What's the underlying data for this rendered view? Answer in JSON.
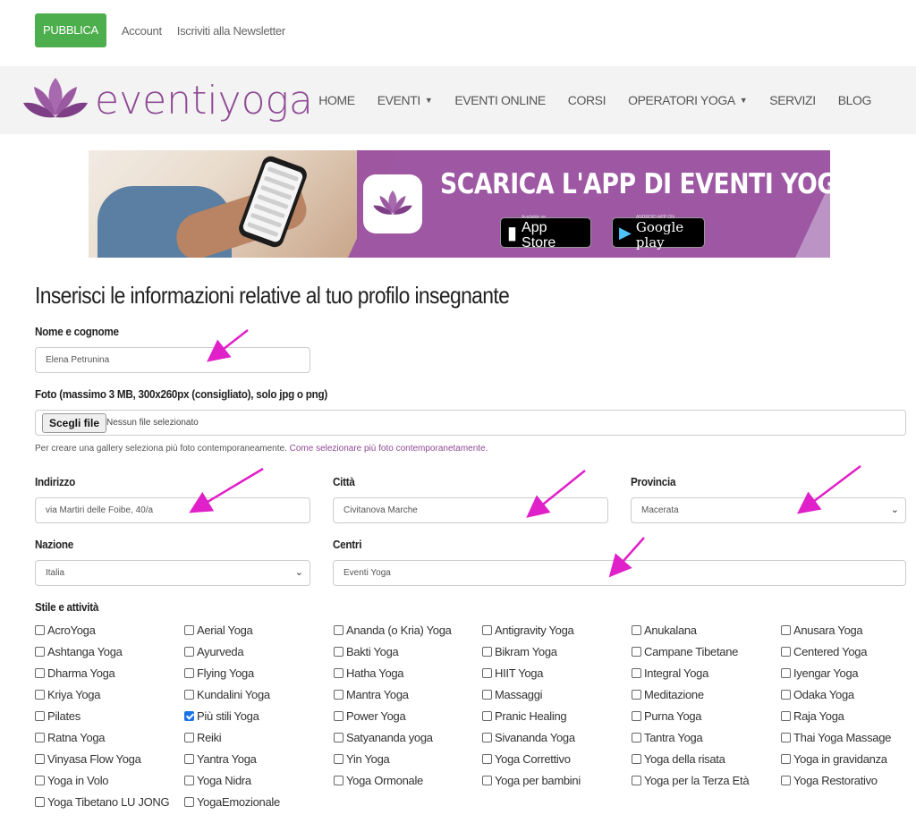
{
  "topbar": {
    "publish_label": "PUBBLICA",
    "account_label": "Account",
    "newsletter_label": "Iscriviti alla Newsletter"
  },
  "brand": {
    "logo_text": "eventiyoga",
    "color": "#8e4a94"
  },
  "nav": {
    "items": [
      "HOME",
      "EVENTI",
      "EVENTI ONLINE",
      "CORSI",
      "OPERATORI YOGA",
      "SERVIZI",
      "BLOG"
    ]
  },
  "banner": {
    "title": "SCARICA L'APP  DI EVENTI YOGA",
    "apple_small": "Available on",
    "apple_label": "App Store",
    "google_small": "ANDROID APP ON",
    "google_label": "Google play"
  },
  "form": {
    "title": "Inserisci le informazioni relative al tuo profilo insegnante",
    "name_label": "Nome e cognome",
    "name_value": "Elena Petrunina",
    "photo_label": "Foto (massimo 3 MB, 300x260px (consigliato), solo jpg o png)",
    "file_button": "Scegli file",
    "file_status": "Nessun file selezionato",
    "hint_text": "Per creare una gallery seleziona più foto contemporaneamente.",
    "hint_link": "Come selezionare più foto contemporanetamente.",
    "address_label": "Indirizzo",
    "address_value": "via Martiri delle Foibe, 40/a",
    "city_label": "Città",
    "city_value": "Civitanova Marche",
    "province_label": "Provincia",
    "province_value": "Macerata",
    "country_label": "Nazione",
    "country_value": "Italia",
    "centers_label": "Centri",
    "centers_value": "Eventi Yoga",
    "styles_label": "Stile e attività"
  },
  "styles": [
    [
      "AcroYoga",
      "Aerial Yoga",
      "Ananda (o Kria) Yoga",
      "Antigravity Yoga",
      "Anukalana",
      "Anusara Yoga"
    ],
    [
      "Ashtanga Yoga",
      "Ayurveda",
      "Bakti Yoga",
      "Bikram Yoga",
      "Campane Tibetane",
      "Centered Yoga"
    ],
    [
      "Dharma Yoga",
      "Flying Yoga",
      "Hatha Yoga",
      "HIIT Yoga",
      "Integral Yoga",
      "Iyengar Yoga"
    ],
    [
      "Kriya Yoga",
      "Kundalini Yoga",
      "Mantra Yoga",
      "Massaggi",
      "Meditazione",
      "Odaka Yoga"
    ],
    [
      "Pilates",
      "Più stili Yoga",
      "Power Yoga",
      "Pranic Healing",
      "Purna Yoga",
      "Raja Yoga"
    ],
    [
      "Ratna Yoga",
      "Reiki",
      "Satyananda yoga",
      "Sivananda Yoga",
      "Tantra Yoga",
      "Thai Yoga Massage"
    ],
    [
      "Vinyasa Flow Yoga",
      "Yantra Yoga",
      "Yin Yoga",
      "Yoga Correttivo",
      "Yoga della risata",
      "Yoga in gravidanza"
    ],
    [
      "Yoga in Volo",
      "Yoga Nidra",
      "Yoga Ormonale",
      "Yoga per bambini",
      "Yoga per la Terza Età",
      "Yoga Restorativo"
    ],
    [
      "Yoga Tibetano LU JONG",
      "YogaEmozionale"
    ]
  ],
  "checked_styles": [
    "Più stili Yoga"
  ],
  "colors": {
    "publish_green": "#4cae4c",
    "accent_purple": "#8e4a94",
    "annotation_magenta": "#e020c8",
    "checkbox_blue": "#1a73e8"
  }
}
